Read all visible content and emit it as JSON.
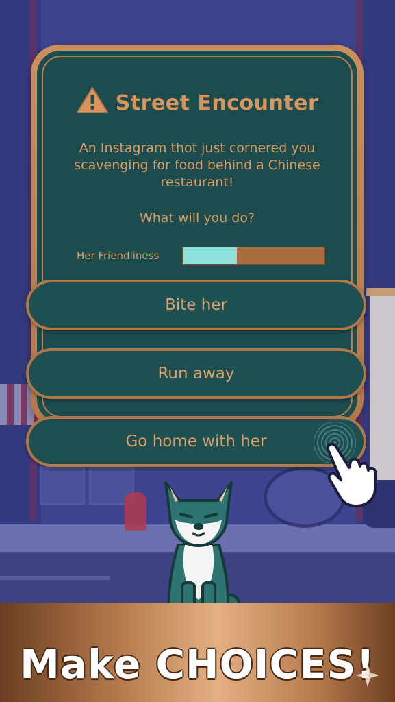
{
  "dialog": {
    "title": "Street Encounter",
    "icon": "warning-icon",
    "description": "An Instagram thot just cornered you scavenging for food behind a Chinese restaurant!",
    "question": "What will you do?",
    "meter": {
      "label": "Her Friendliness",
      "value": 0.38
    }
  },
  "choices": [
    {
      "label": "Bite her"
    },
    {
      "label": "Run away"
    },
    {
      "label": "Go home with her"
    }
  ],
  "banner": {
    "text": "Make CHOICES!"
  },
  "colors": {
    "card_bg": "#1d4c4e",
    "card_border": "#b98152",
    "text_accent": "#d9955c",
    "meter_fill": "#8fe0da",
    "meter_track": "#a96e3f",
    "banner_text": "#ffffff"
  }
}
